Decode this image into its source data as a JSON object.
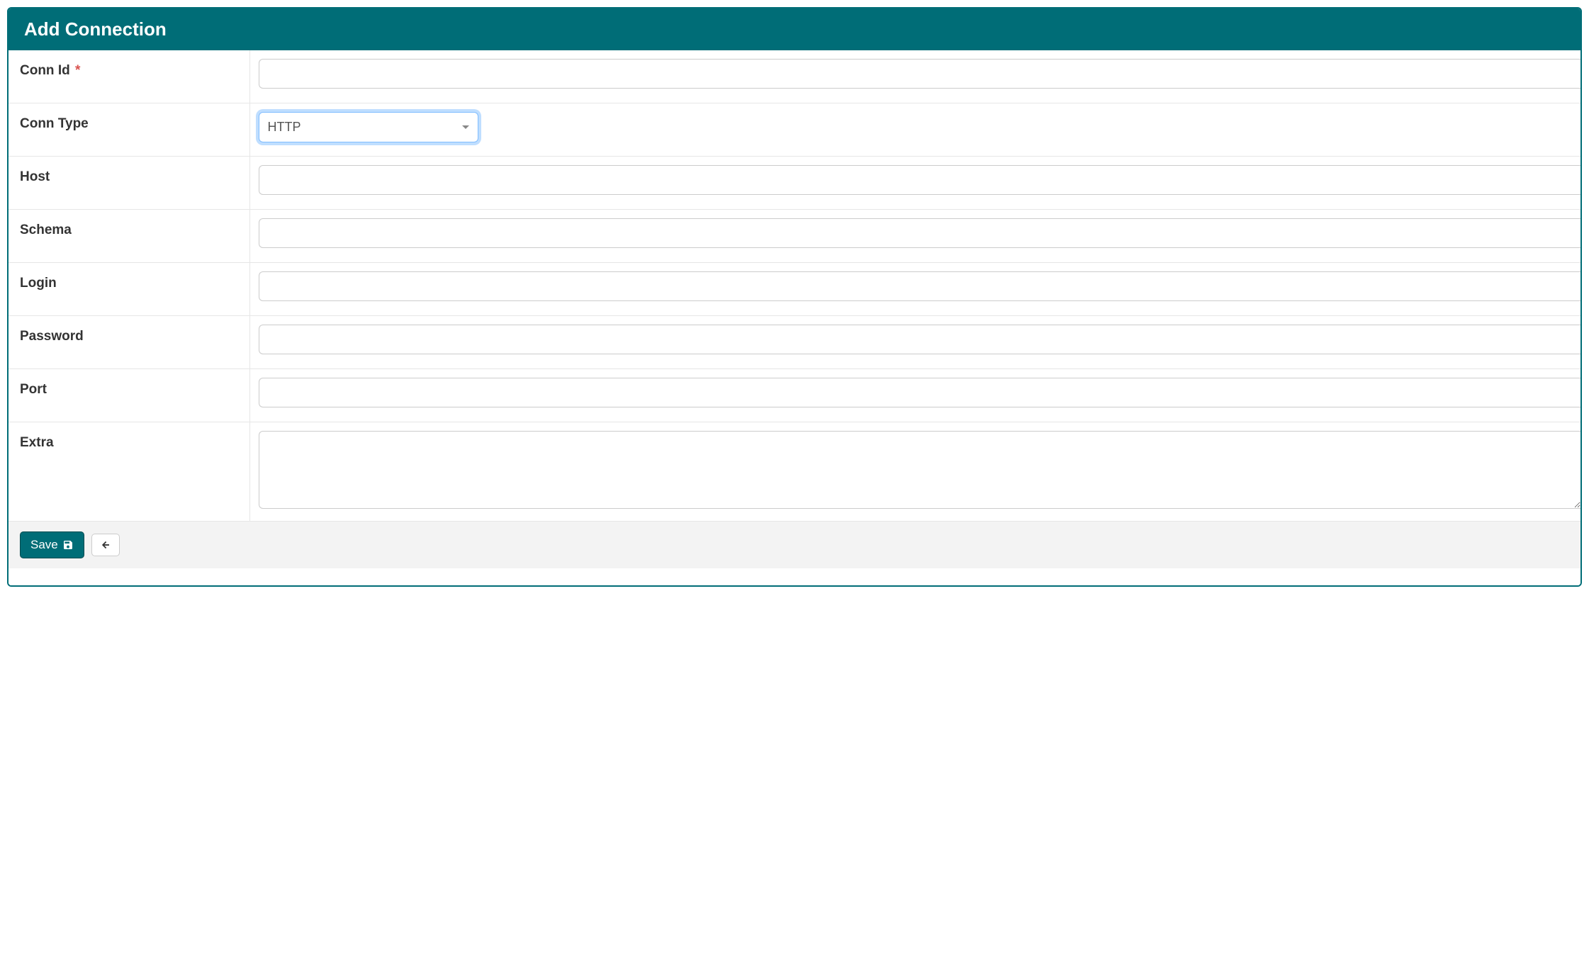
{
  "header": {
    "title": "Add Connection"
  },
  "form": {
    "conn_id": {
      "label": "Conn Id",
      "required_marker": "*",
      "value": ""
    },
    "conn_type": {
      "label": "Conn Type",
      "selected": "HTTP"
    },
    "host": {
      "label": "Host",
      "value": ""
    },
    "schema": {
      "label": "Schema",
      "value": ""
    },
    "login": {
      "label": "Login",
      "value": ""
    },
    "password": {
      "label": "Password",
      "value": ""
    },
    "port": {
      "label": "Port",
      "value": ""
    },
    "extra": {
      "label": "Extra",
      "value": ""
    }
  },
  "footer": {
    "save_label": "Save"
  }
}
